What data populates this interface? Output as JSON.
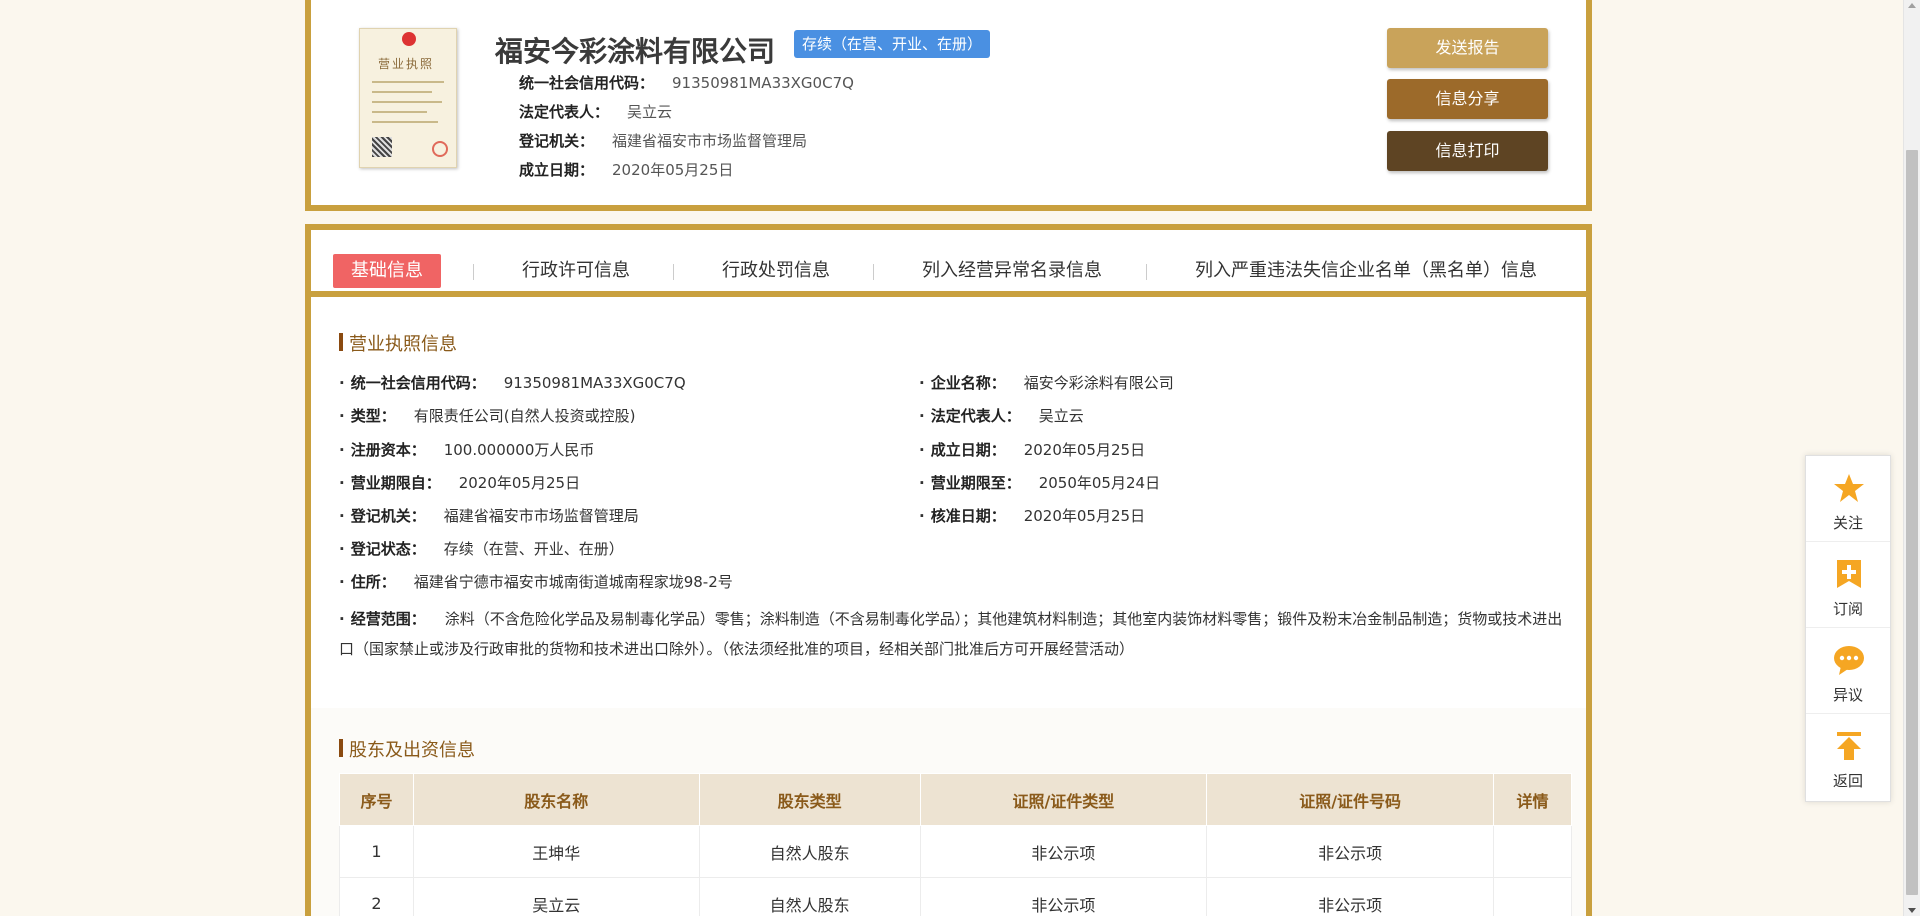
{
  "header": {
    "company_name": "福安今彩涂料有限公司",
    "status": "存续（在营、开业、在册）",
    "rows": [
      {
        "label": "统一社会信用代码：",
        "value": "91350981MA33XG0C7Q"
      },
      {
        "label": "法定代表人：",
        "value": "吴立云"
      },
      {
        "label": "登记机关：",
        "value": "福建省福安市市场监督管理局"
      },
      {
        "label": "成立日期：",
        "value": "2020年05月25日"
      }
    ],
    "license_image_title": "营业执照",
    "buttons": {
      "send": "发送报告",
      "share": "信息分享",
      "print": "信息打印"
    }
  },
  "tabs": [
    {
      "label": "基础信息",
      "active": true
    },
    {
      "label": "行政许可信息"
    },
    {
      "label": "行政处罚信息"
    },
    {
      "label": "列入经营异常名录信息"
    },
    {
      "label": "列入严重违法失信企业名单（黑名单）信息"
    }
  ],
  "license_section": {
    "title": "营业执照信息",
    "left": [
      {
        "label": "统一社会信用代码：",
        "value": "91350981MA33XG0C7Q"
      },
      {
        "label": "类型：",
        "value": "有限责任公司(自然人投资或控股)"
      },
      {
        "label": "注册资本：",
        "value": "100.000000万人民币"
      },
      {
        "label": "营业期限自：",
        "value": "2020年05月25日"
      },
      {
        "label": "登记机关：",
        "value": "福建省福安市市场监督管理局"
      },
      {
        "label": "登记状态：",
        "value": "存续（在营、开业、在册）"
      },
      {
        "label": "住所：",
        "value": "福建省宁德市福安市城南街道城南程家垅98-2号"
      }
    ],
    "right": [
      {
        "label": "企业名称：",
        "value": "福安今彩涂料有限公司"
      },
      {
        "label": "法定代表人：",
        "value": "吴立云"
      },
      {
        "label": "成立日期：",
        "value": "2020年05月25日"
      },
      {
        "label": "营业期限至：",
        "value": "2050年05月24日"
      },
      {
        "label": "核准日期：",
        "value": "2020年05月25日"
      }
    ],
    "scope_label": "经营范围：",
    "scope_value": "涂料（不含危险化学品及易制毒化学品）零售；涂料制造（不含易制毒化学品）；其他建筑材料制造；其他室内装饰材料零售；锻件及粉末冶金制品制造；货物或技术进出口（国家禁止或涉及行政审批的货物和技术进出口除外）。（依法须经批准的项目，经相关部门批准后方可开展经营活动）"
  },
  "shareholder_section": {
    "title": "股东及出资信息",
    "columns": [
      "序号",
      "股东名称",
      "股东类型",
      "证照/证件类型",
      "证照/证件号码",
      "详情"
    ],
    "rows": [
      [
        "1",
        "王坤华",
        "自然人股东",
        "非公示项",
        "非公示项",
        ""
      ],
      [
        "2",
        "吴立云",
        "自然人股东",
        "非公示项",
        "非公示项",
        ""
      ]
    ]
  },
  "side_toolbar": [
    {
      "label": "关注",
      "icon": "star-icon"
    },
    {
      "label": "订阅",
      "icon": "bookmark-plus-icon"
    },
    {
      "label": "异议",
      "icon": "chat-bubble-icon"
    },
    {
      "label": "返回",
      "icon": "arrow-up-icon"
    }
  ],
  "colors": {
    "gold_border": "#c9a03e",
    "tab_active": "#f06464",
    "status_badge": "#4a90e2",
    "icon_orange": "#f5a623"
  }
}
